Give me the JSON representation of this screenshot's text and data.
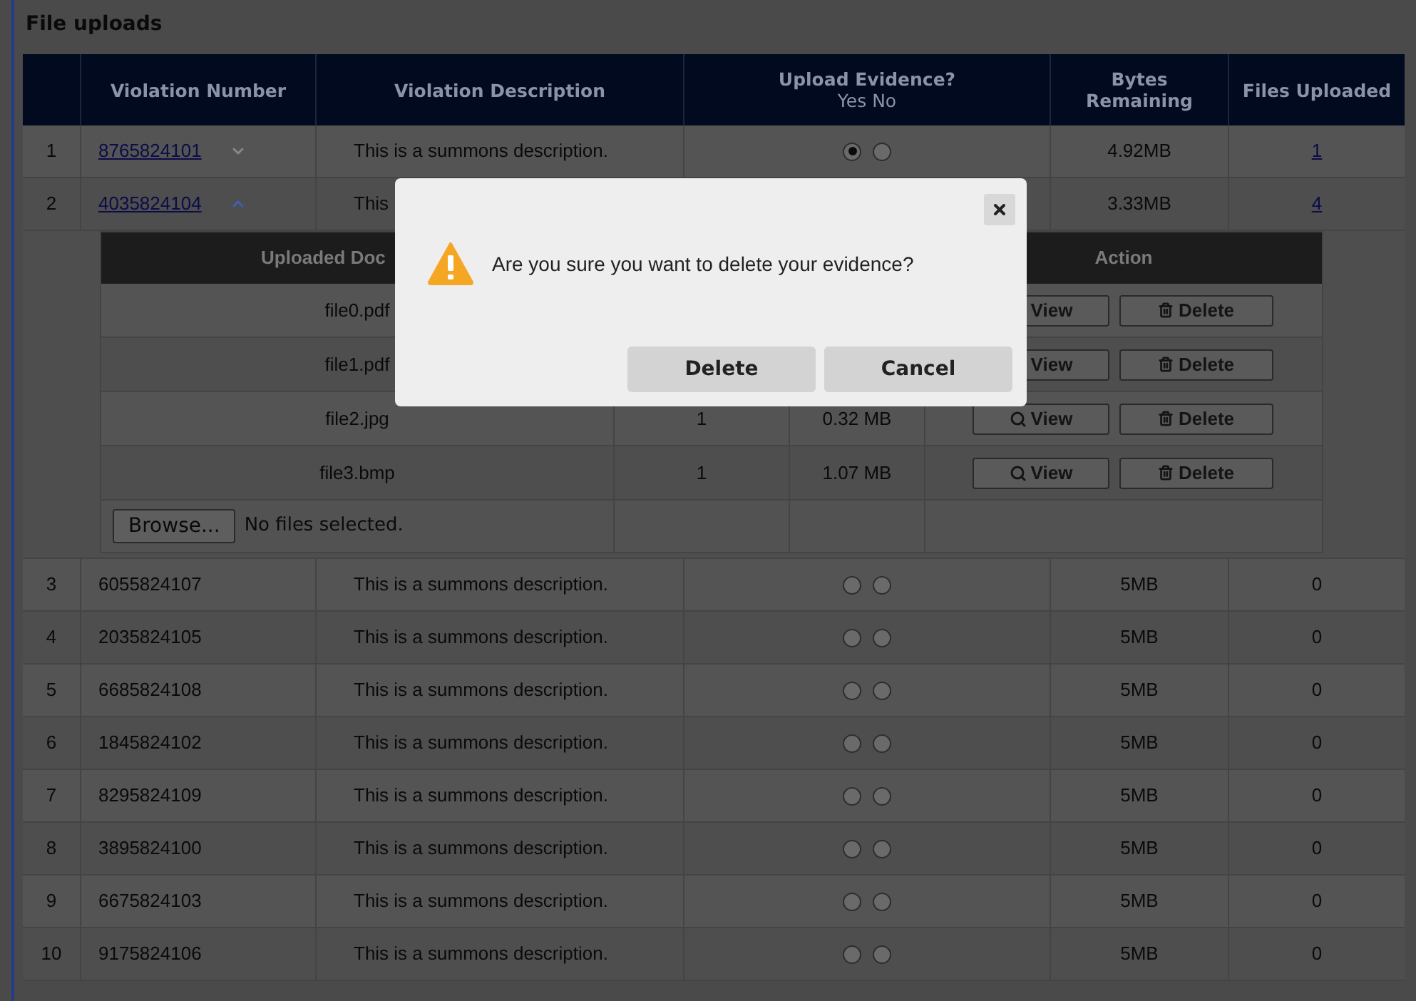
{
  "title": "File uploads",
  "table": {
    "columns": [
      {
        "label": "Violation Number"
      },
      {
        "label": "Violation Description"
      },
      {
        "label": "Upload Evidence?",
        "sublabel": "Yes No"
      },
      {
        "label": "Bytes Remaining"
      },
      {
        "label": "Files Uploaded"
      }
    ],
    "rows": [
      {
        "index": "1",
        "number": "8765824101",
        "link": true,
        "expanded": false,
        "description": "This is a summons description.",
        "yes": true,
        "no": false,
        "bytes": "4.92MB",
        "files": "1"
      },
      {
        "index": "2",
        "number": "4035824104",
        "link": true,
        "expanded": true,
        "description": "This",
        "bytes": "3.33MB",
        "files": "4",
        "details": {
          "column_1": "Uploaded Doc",
          "column_4": "Action",
          "files": [
            {
              "name": "file0.pdf",
              "view": "View",
              "delete": "Delete"
            },
            {
              "name": "file1.pdf",
              "view": "View",
              "delete": "Delete"
            },
            {
              "name": "file2.jpg",
              "count": "1",
              "size": "0.32 MB",
              "view": "View",
              "delete": "Delete"
            },
            {
              "name": "file3.bmp",
              "count": "1",
              "size": "1.07 MB",
              "view": "View",
              "delete": "Delete"
            }
          ],
          "browse": "Browse...",
          "file_status": "No files selected."
        }
      },
      {
        "index": "3",
        "number": "6055824107",
        "link": false,
        "description": "This is a summons description.",
        "yes": false,
        "no": false,
        "bytes": "5MB",
        "files": "0"
      },
      {
        "index": "4",
        "number": "2035824105",
        "link": false,
        "description": "This is a summons description.",
        "yes": false,
        "no": false,
        "bytes": "5MB",
        "files": "0"
      },
      {
        "index": "5",
        "number": "6685824108",
        "link": false,
        "description": "This is a summons description.",
        "yes": false,
        "no": false,
        "bytes": "5MB",
        "files": "0"
      },
      {
        "index": "6",
        "number": "1845824102",
        "link": false,
        "description": "This is a summons description.",
        "yes": false,
        "no": false,
        "bytes": "5MB",
        "files": "0"
      },
      {
        "index": "7",
        "number": "8295824109",
        "link": false,
        "description": "This is a summons description.",
        "yes": false,
        "no": false,
        "bytes": "5MB",
        "files": "0"
      },
      {
        "index": "8",
        "number": "3895824100",
        "link": false,
        "description": "This is a summons description.",
        "yes": false,
        "no": false,
        "bytes": "5MB",
        "files": "0"
      },
      {
        "index": "9",
        "number": "6675824103",
        "link": false,
        "description": "This is a summons description.",
        "yes": false,
        "no": false,
        "bytes": "5MB",
        "files": "0"
      },
      {
        "index": "10",
        "number": "9175824106",
        "link": false,
        "description": "This is a summons description.",
        "yes": false,
        "no": false,
        "bytes": "5MB",
        "files": "0"
      }
    ]
  },
  "dialog": {
    "message": "Are you sure you want to delete your evidence?",
    "buttons": [
      "Delete",
      "Cancel"
    ]
  }
}
